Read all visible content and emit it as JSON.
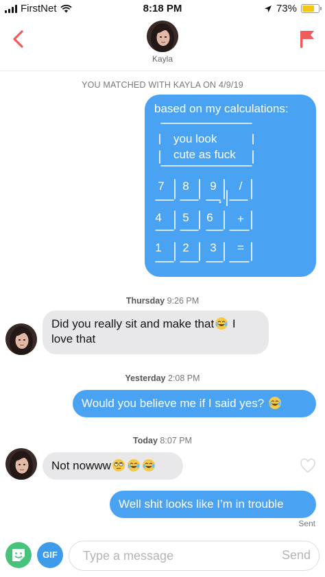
{
  "status_bar": {
    "carrier": "FirstNet",
    "time": "8:18 PM",
    "battery_percent": "73%",
    "battery_level": 0.73,
    "icons": [
      "signal-bars-icon",
      "wifi-icon",
      "location-arrow-icon",
      "battery-icon"
    ]
  },
  "header": {
    "contact_name": "Kayla",
    "back_icon": "chevron-left-icon",
    "report_icon": "flag-icon",
    "accent_color": "#ef5a5a"
  },
  "match_banner": "YOU MATCHED WITH KAYLA ON 4/9/19",
  "messages": [
    {
      "id": "m1",
      "direction": "outgoing",
      "title": "based on my calculations:",
      "screen_lines": [
        "you look",
        "cute as fuck"
      ],
      "keys": [
        "7",
        "8",
        "9",
        "/",
        "4",
        "5",
        "6",
        "+",
        "1",
        "2",
        "3",
        "="
      ]
    },
    {
      "id": "m2",
      "direction": "incoming",
      "text": "Did you really sit and make that",
      "emoji": "tears-of-joy-emoji",
      "text_after": " I love that"
    },
    {
      "id": "m3",
      "direction": "outgoing",
      "text": "Would you believe me if I said yes?",
      "emoji": "tears-of-joy-emoji"
    },
    {
      "id": "m4",
      "direction": "incoming",
      "text": "Not nowww",
      "emojis": [
        "rolling-eyes-emoji",
        "tears-of-joy-emoji",
        "tears-of-joy-emoji"
      ]
    },
    {
      "id": "m5",
      "direction": "outgoing",
      "text": "Well shit looks like I’m in trouble",
      "status": "Sent"
    }
  ],
  "timestamps": [
    {
      "day": "Thursday",
      "time": "9:26 PM"
    },
    {
      "day": "Yesterday",
      "time": "2:08 PM"
    },
    {
      "day": "Today",
      "time": "8:07 PM"
    }
  ],
  "composer": {
    "placeholder": "Type a message",
    "send_label": "Send",
    "gif_label": "GIF",
    "sticker_icon": "sticker-face-icon"
  },
  "colors": {
    "outgoing_bubble": "#4aa3f2",
    "incoming_bubble": "#e8e8ea",
    "sticker_button": "#47c27a",
    "gif_button": "#3d9be9"
  }
}
